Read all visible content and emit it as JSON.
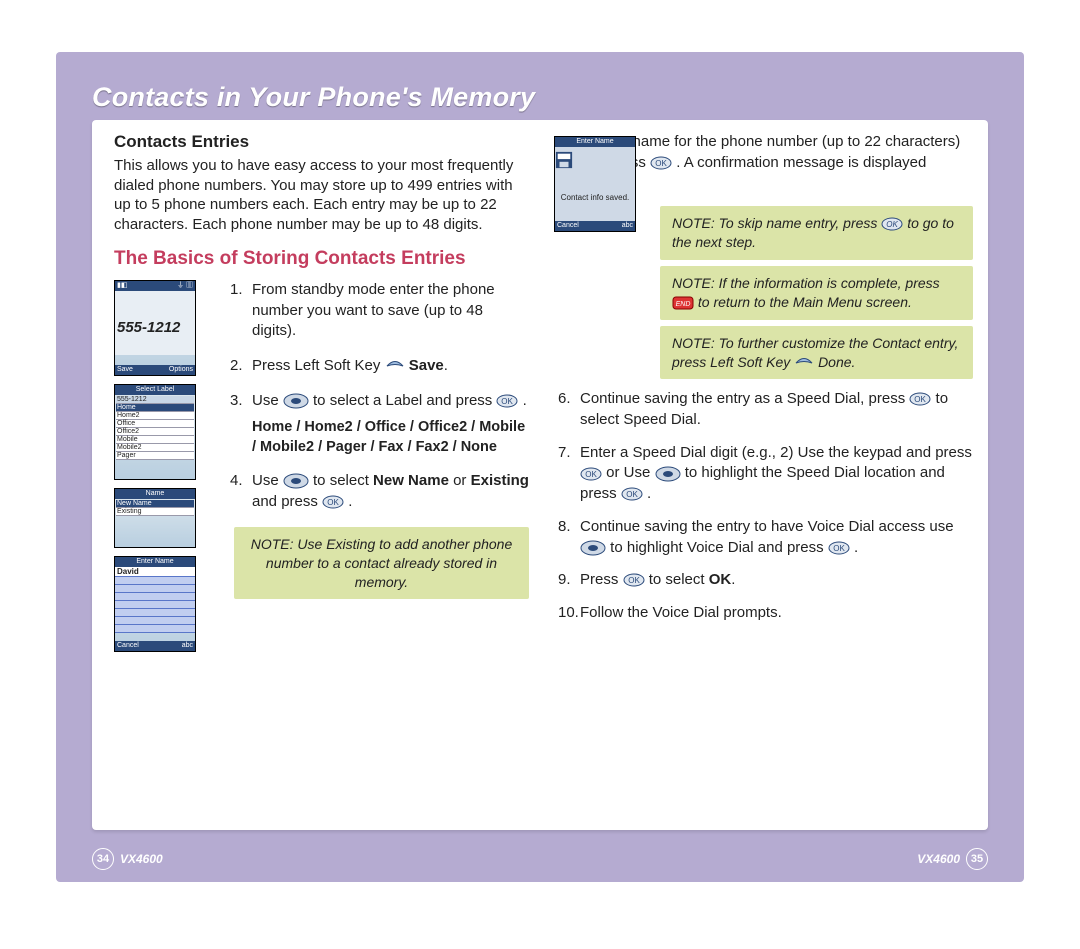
{
  "page_header": "Contacts in Your Phone's Memory",
  "left": {
    "h1": "Contacts Entries",
    "intro": "This allows you to have easy access to your most frequently dialed phone numbers. You may store up to 499 entries with up to 5 phone numbers each. Each entry may be up to 22 characters. Each phone number may be up to 48 digits.",
    "h2": "The Basics of Storing Contacts Entries",
    "phone1_number": "555-1212",
    "phone1_bl": "Save",
    "phone1_br": "Options",
    "phone2_title": "Select Label",
    "phone2_number": "555-1212",
    "phone2_items": [
      "Home",
      "Home2",
      "Office",
      "Office2",
      "Mobile",
      "Mobile2",
      "Pager"
    ],
    "phone3_title": "Name",
    "phone3_items": [
      "New Name",
      "Existing"
    ],
    "phone4_title": "Enter Name",
    "phone4_name": "David",
    "phone4_bl": "Cancel",
    "phone4_br": "abc",
    "steps": {
      "1": "From standby mode enter the phone number you want to save (up to 48 digits).",
      "2_pre": "Press Left Soft Key ",
      "2_post": " Save",
      "3_pre": "Use ",
      "3_mid": " to select a Label and press ",
      "3_post": " .",
      "labels": "Home / Home2 / Office / Office2 / Mobile / Mobile2 / Pager / Fax / Fax2 / None",
      "4_pre": "Use ",
      "4_mid": " to select ",
      "4_new": "New Name",
      "4_or": " or ",
      "4_exist": "Existing",
      "4_post": " and press "
    },
    "note1": "NOTE: Use Existing to add another phone number to a contact already stored in memory."
  },
  "right": {
    "phone_title": "Enter Name",
    "phone_msg": "Contact info saved.",
    "phone_bl": "Cancel",
    "phone_br": "abc",
    "step5_a": "Enter a name for the phone number (up to 22 characters) and press ",
    "step5_b": ". A confirmation message is displayed briefly.",
    "noteA_pre": "NOTE: To skip name entry, press ",
    "noteA_post": " to go to the next step.",
    "noteB_pre": "NOTE: If the information is complete, press ",
    "noteB_post": " to return to the Main Menu screen.",
    "noteC_pre": "NOTE: To further customize the Contact entry, press Left Soft Key ",
    "noteC_post": " Done.",
    "step6_a": "Continue saving the entry as a Speed Dial, press ",
    "step6_b": " to select Speed Dial.",
    "step7_a": "Enter a Speed Dial digit (e.g., 2) Use the keypad and press ",
    "step7_b": " or Use ",
    "step7_c": " to highlight the Speed Dial location and press ",
    "step8_a": "Continue saving the entry to have Voice Dial access use ",
    "step8_b": " to highlight Voice Dial and press ",
    "step9_a": "Press ",
    "step9_b": " to select ",
    "step9_ok": "OK",
    "step10": "Follow the Voice Dial prompts."
  },
  "footer": {
    "model": "VX4600",
    "page_left": "34",
    "page_right": "35"
  }
}
